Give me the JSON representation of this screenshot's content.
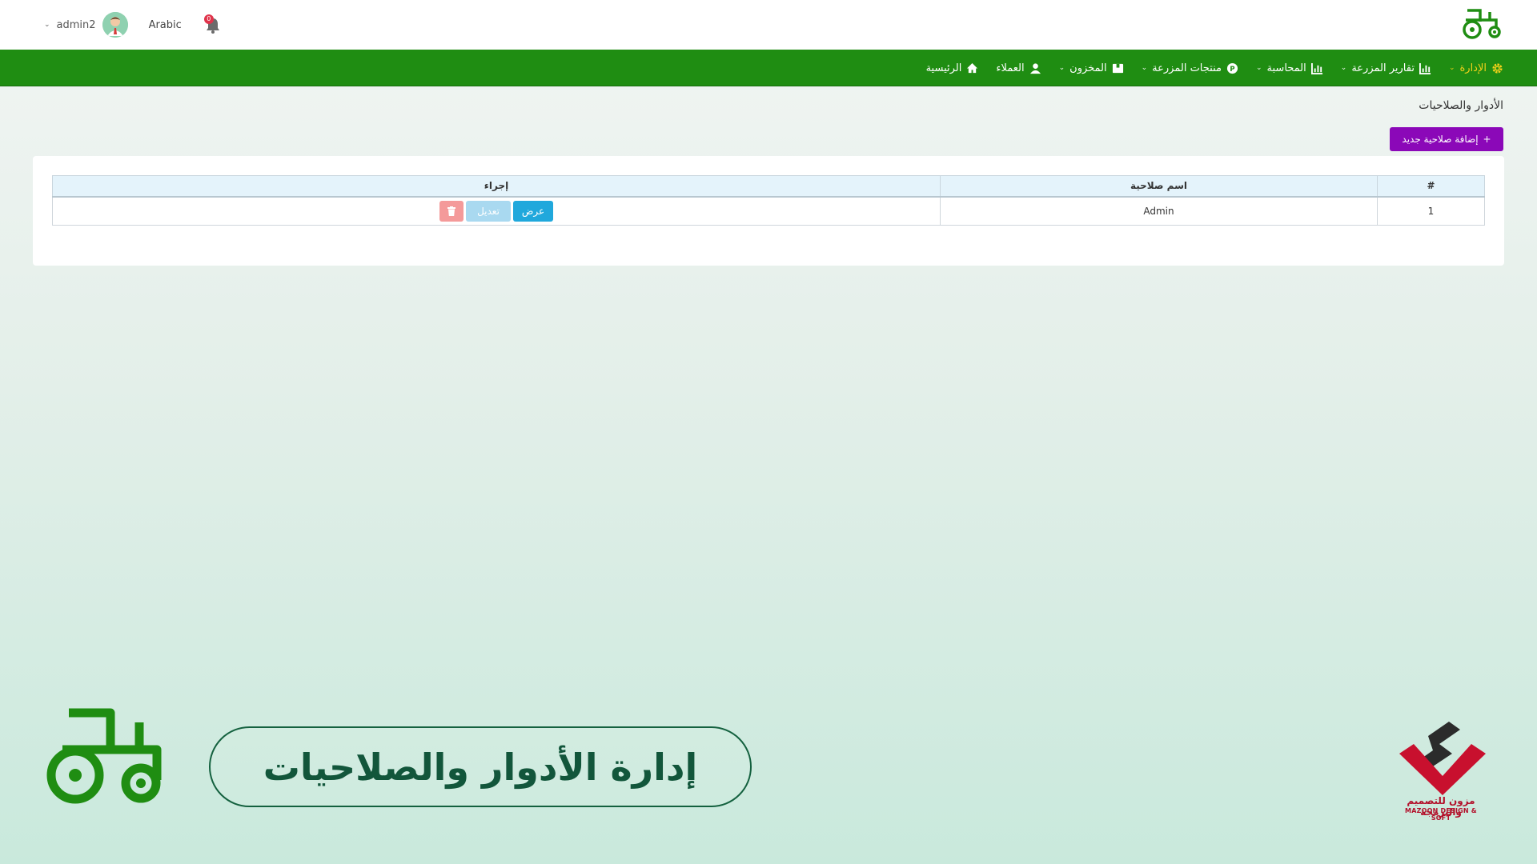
{
  "header": {
    "username": "admin2",
    "language": "Arabic",
    "notifications_count": "0"
  },
  "nav": {
    "items": [
      {
        "label": "الرئيسية",
        "icon": "home-icon",
        "has_dropdown": false
      },
      {
        "label": "العملاء",
        "icon": "user-icon",
        "has_dropdown": false
      },
      {
        "label": "المخزون",
        "icon": "box-icon",
        "has_dropdown": true
      },
      {
        "label": "منتجات المزرعة",
        "icon": "product-icon",
        "has_dropdown": true
      },
      {
        "label": "المحاسبة",
        "icon": "chart-icon",
        "has_dropdown": true
      },
      {
        "label": "تقارير المزرعة",
        "icon": "chart-icon",
        "has_dropdown": true
      },
      {
        "label": "الإدارة",
        "icon": "gear-icon",
        "has_dropdown": true,
        "active": true
      }
    ],
    "active_color": "#f4d21a",
    "bar_color": "#1f8d12"
  },
  "page": {
    "title": "الأدوار والصلاحيات",
    "add_button_label": "إضافة صلاحية جديد",
    "add_button_icon": "+"
  },
  "table": {
    "headers": [
      "#",
      "اسم صلاحية",
      "إجراء"
    ],
    "rows": [
      {
        "num": "1",
        "name": "Admin",
        "view_label": "عرض",
        "edit_label": "تعديل"
      }
    ]
  },
  "branding": {
    "banner_text": "إدارة الأدوار والصلاحيات",
    "company_ar": "مزون للتصميم والبرمجة",
    "company_en": "MAZOON DESIGN & SOFT"
  }
}
